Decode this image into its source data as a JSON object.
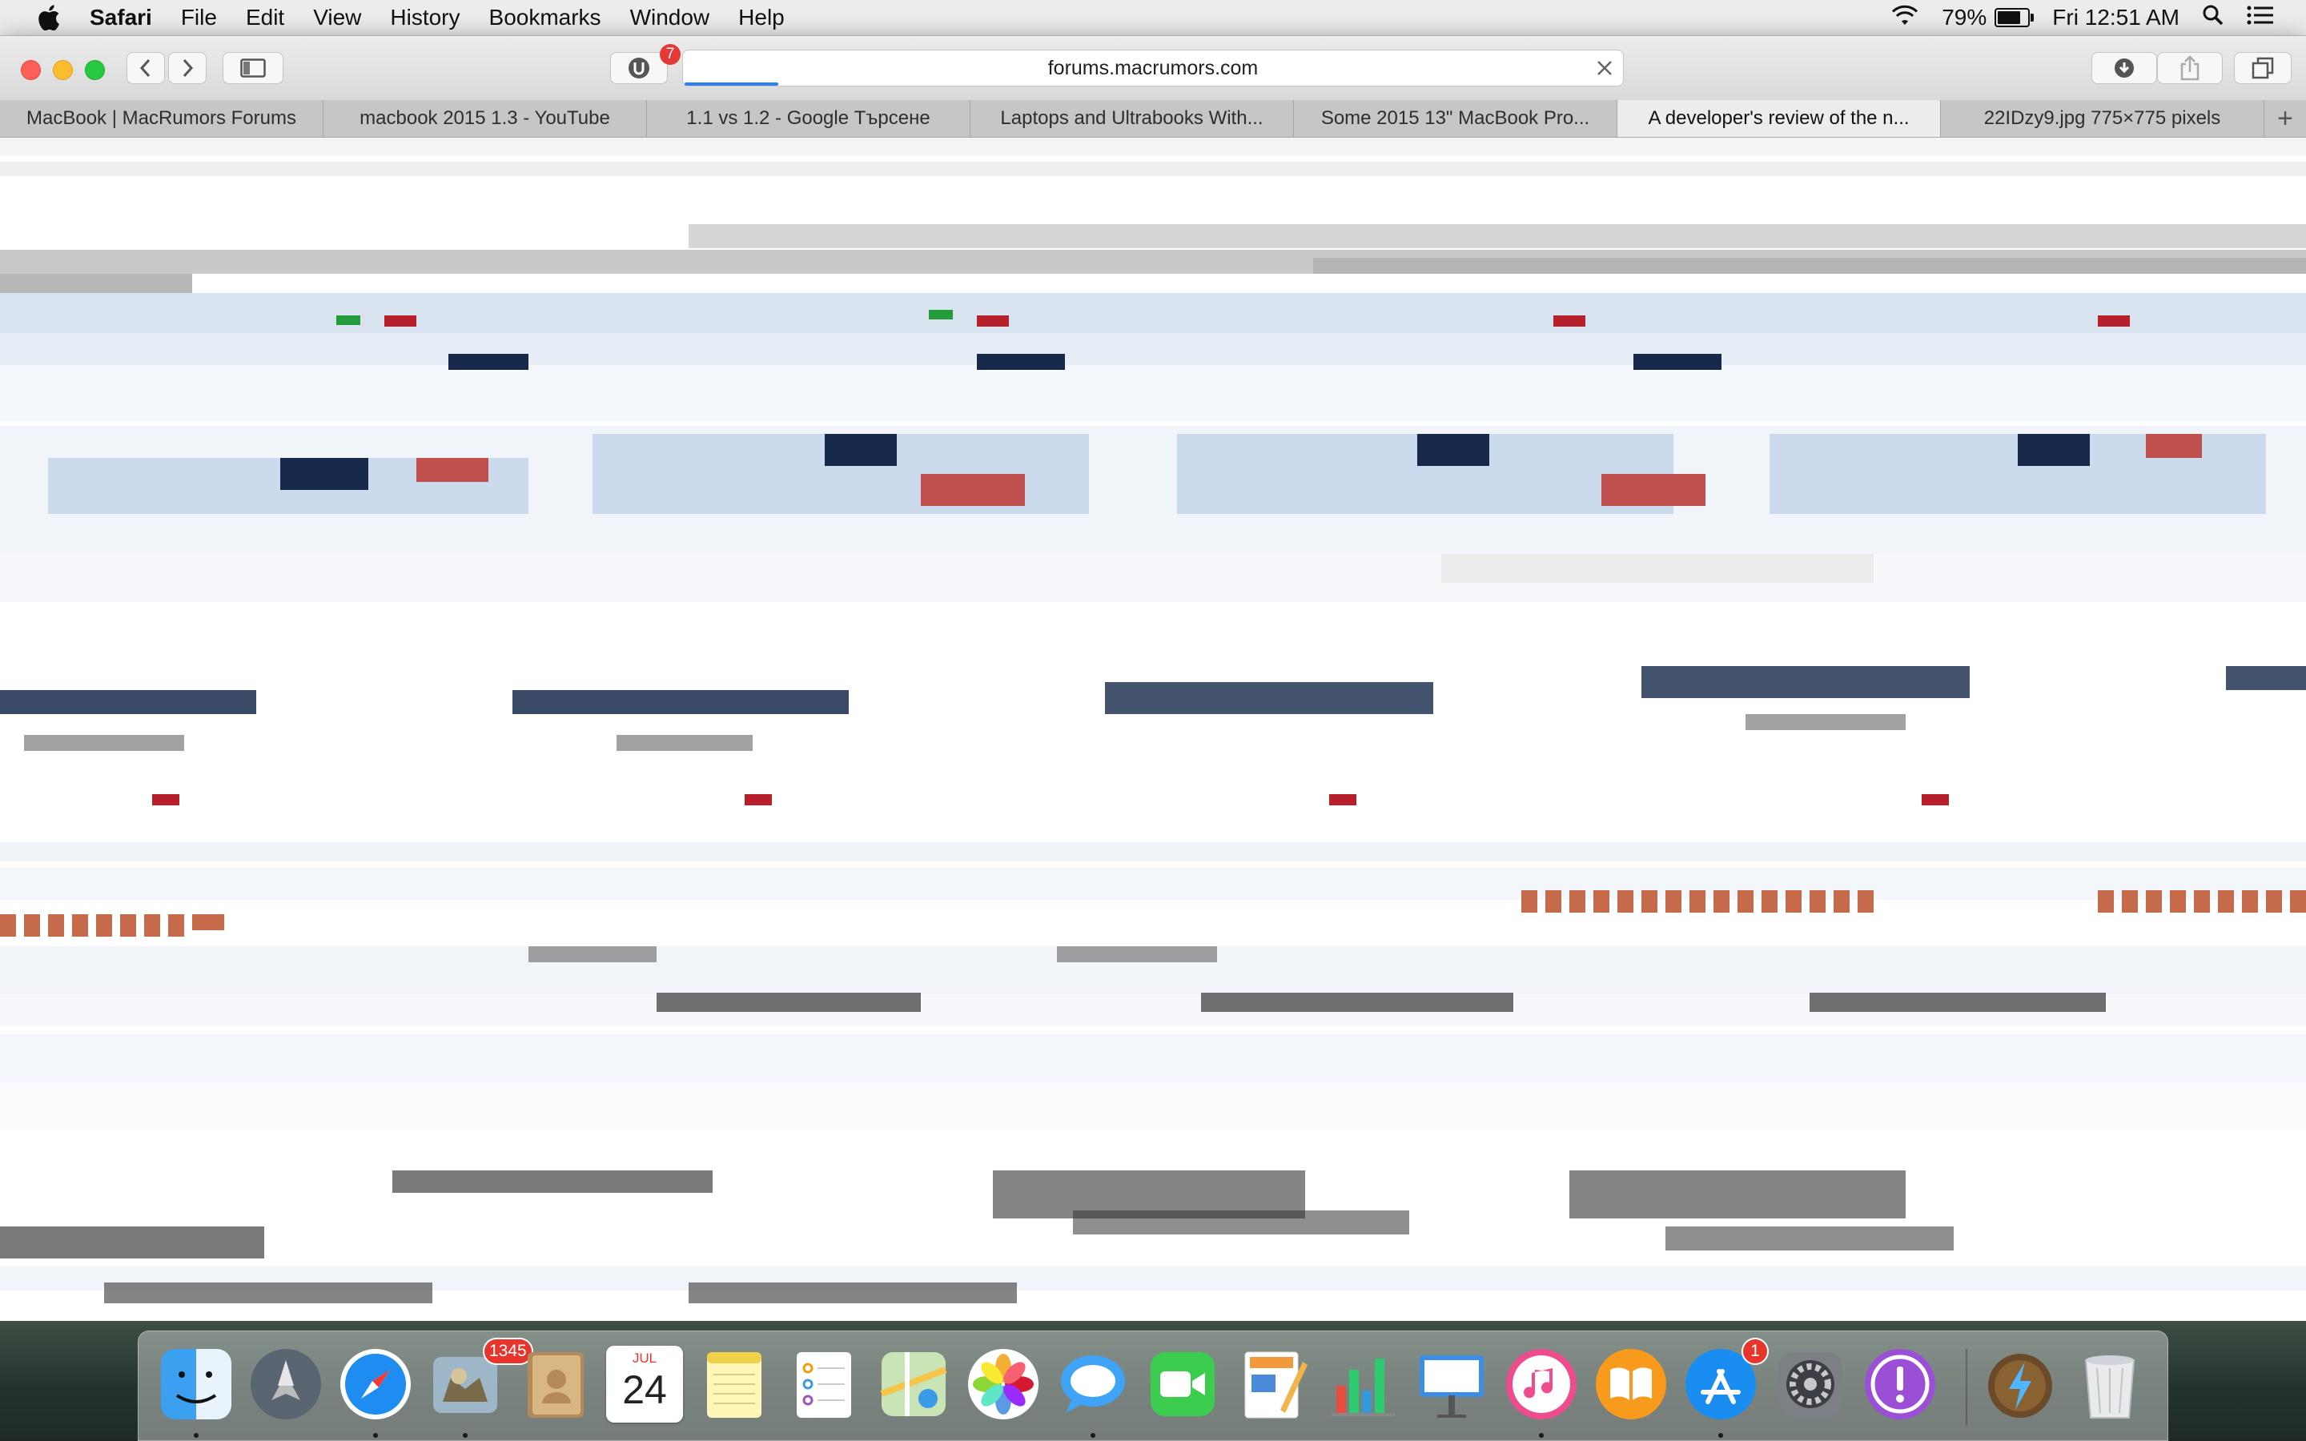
{
  "menubar": {
    "app_name": "Safari",
    "menus": [
      "File",
      "Edit",
      "View",
      "History",
      "Bookmarks",
      "Window",
      "Help"
    ],
    "battery_percent": "79%",
    "battery_level": 0.79,
    "clock": "Fri 12:51 AM"
  },
  "toolbar": {
    "url": "forums.macrumors.com",
    "extension_badge": "7",
    "load_progress": 0.1
  },
  "tabs": [
    {
      "label": "MacBook | MacRumors Forums",
      "active": false
    },
    {
      "label": "macbook 2015 1.3 - YouTube",
      "active": false
    },
    {
      "label": "1.1 vs 1.2 - Google Търсене",
      "active": false
    },
    {
      "label": "Laptops and Ultrabooks With...",
      "active": false
    },
    {
      "label": "Some 2015 13\" MacBook Pro...",
      "active": false
    },
    {
      "label": "A developer's review of the n...",
      "active": true
    },
    {
      "label": "22IDzy9.jpg 775×775 pixels",
      "active": false
    }
  ],
  "dock": {
    "mail_badge": "1345",
    "calendar_month": "JUL",
    "calendar_day": "24",
    "appstore_badge": "1",
    "apps": [
      "Finder",
      "Launchpad",
      "Safari",
      "Mail",
      "Contacts",
      "Calendar",
      "Notes",
      "Reminders",
      "Maps",
      "Photos",
      "Messages",
      "FaceTime",
      "Pages",
      "Numbers",
      "Keynote",
      "iTunes",
      "iBooks",
      "App Store",
      "System Preferences",
      "Feedback Assistant",
      "Reeder",
      "Trash"
    ]
  },
  "colors": {
    "accent_blue": "#2f7cf6",
    "navy": "#17294a",
    "brick_red": "#c0504d",
    "light_blue": "#d5e2f1",
    "badge_red": "#e53935"
  }
}
